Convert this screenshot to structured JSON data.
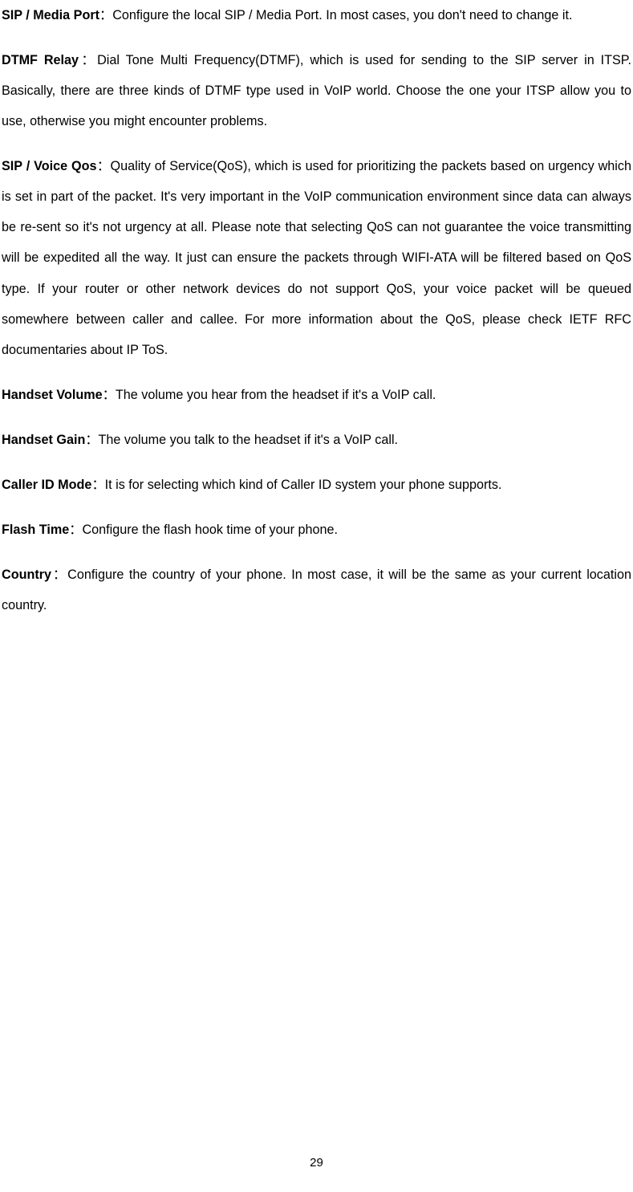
{
  "paragraphs": [
    {
      "term": "SIP / Media Port",
      "sep": "：",
      "text": "Configure the local SIP / Media Port. In most cases, you don't need to change it."
    },
    {
      "term": "DTMF Relay",
      "sep": "：",
      "text": "Dial Tone Multi Frequency(DTMF), which is used for sending to the SIP server in ITSP. Basically, there are three kinds of DTMF type used in VoIP world. Choose the one your ITSP allow you to use, otherwise you might encounter problems."
    },
    {
      "term": "SIP / Voice Qos",
      "sep": "：",
      "text": "Quality of Service(QoS), which is used for prioritizing the packets based on urgency which is set in part of the packet. It's very important in the VoIP communication environment since data can always be re-sent so it's not urgency at all. Please note that selecting QoS can not guarantee the voice transmitting will be expedited all the way. It just can ensure the packets through WIFI-ATA will be filtered based on QoS type. If your router or other network devices do not support QoS, your voice packet will be queued somewhere between caller and callee. For more information about the QoS, please check IETF RFC documentaries about IP ToS."
    },
    {
      "term": "Handset Volume",
      "sep": "：",
      "text": "The volume you hear from the headset if it's a VoIP call."
    },
    {
      "term": "Handset Gain",
      "sep": "：",
      "text": "The volume you talk to the headset if it's a VoIP call."
    },
    {
      "term": "Caller ID Mode",
      "sep": "：",
      "text": "It is for selecting which kind of Caller ID system your phone supports."
    },
    {
      "term": "Flash Time",
      "sep": "：",
      "text": "Configure the flash hook time of your phone."
    },
    {
      "term": "Country",
      "sep": "：",
      "text": "Configure the country of your phone. In most case, it will be the same as your current location country."
    }
  ],
  "pageNumber": "29"
}
